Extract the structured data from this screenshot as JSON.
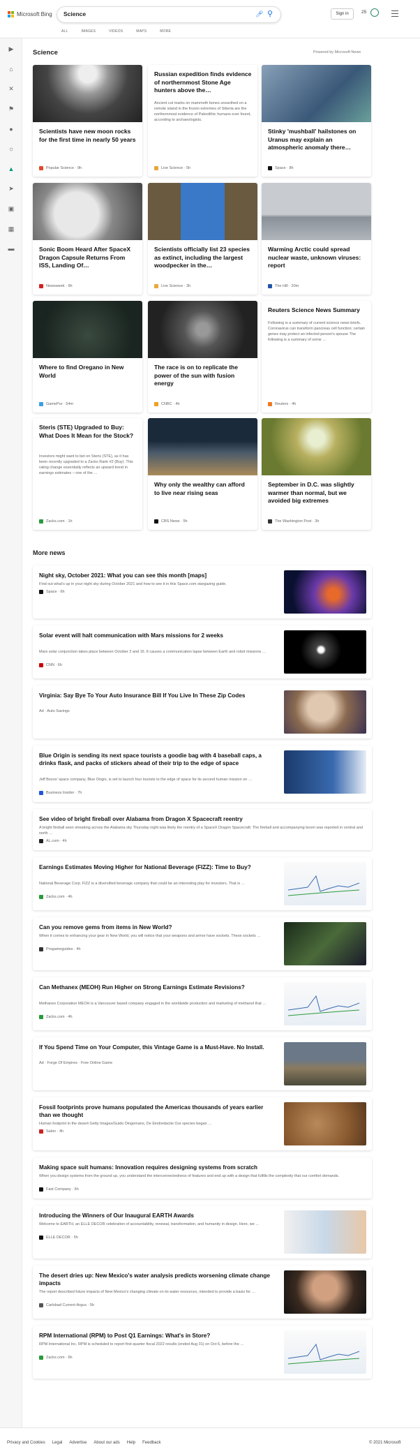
{
  "header": {
    "brand": "Microsoft Bing",
    "query": "Science",
    "signin": "Sign in",
    "rewards": "25",
    "tabs": [
      "ALL",
      "IMAGES",
      "VIDEOS",
      "MAPS",
      "MORE"
    ]
  },
  "section": {
    "title": "Science",
    "powered": "Powered by Microsoft News"
  },
  "cards": [
    {
      "title": "Scientists have new moon rocks for the first time in nearly 50 years",
      "source": "Popular Science · 9h",
      "color": "#e04a2a",
      "img": "moon"
    },
    {
      "title": "Russian expedition finds evidence of northernmost Stone Age hunters above the…",
      "desc": "Ancient cut marks on mammoth bones unearthed on a remote island in the frozen extremes of Siberia are the northernmost evidence of Paleolithic humans ever found, according to archaeologists.",
      "source": "Live Science · 5h",
      "color": "#e8a83a",
      "img": "text"
    },
    {
      "title": "Stinky 'mushball' hailstones on Uranus may explain an atmospheric anomaly there…",
      "source": "Space · 8h",
      "color": "#111",
      "img": "uranus"
    },
    {
      "title": "Sonic Boom Heard After SpaceX Dragon Capsule Returns From ISS, Landing Of…",
      "source": "Newsweek · 9h",
      "color": "#d62020",
      "img": "capsule"
    },
    {
      "title": "Scientists officially list 23 species as extinct, including the largest woodpecker in the…",
      "source": "Live Science · 3h",
      "color": "#e8a83a",
      "img": "woodpecker"
    },
    {
      "title": "Warming Arctic could spread nuclear waste, unknown viruses: report",
      "source": "The Hill · 20m",
      "color": "#2255aa",
      "img": "arctic"
    },
    {
      "title": "Where to find Oregano in New World",
      "source": "GamePur · 54m",
      "color": "#3aa0e0",
      "img": "oregano"
    },
    {
      "title": "The race is on to replicate the power of the sun with fusion energy",
      "source": "CNBC · 4h",
      "color": "#f0a020",
      "img": "fusion"
    },
    {
      "title": "Reuters Science News Summary",
      "desc": "Following is a summary of current science news briefs. Coronavirus can transform pancreas cell function; certain genes may protect an infected person's spouse The following is a summary of some …",
      "source": "Reuters · 4h",
      "color": "#f07820",
      "img": "text"
    },
    {
      "title": "Steris (STE) Upgraded to Buy: What Does It Mean for the Stock?",
      "desc": "Investors might want to bet on Steris (STE), as it has been recently upgraded to a Zacks Rank #2 (Buy). This rating change essentially reflects an upward trend in earnings estimates – one of the …",
      "source": "Zacks.com · 1h",
      "color": "#2a9a3a",
      "img": "text"
    },
    {
      "title": "Why only the wealthy can afford to live near rising seas",
      "source": "CBS News · 5h",
      "color": "#111",
      "img": "flood"
    },
    {
      "title": "September in D.C. was slightly warmer than normal, but we avoided big extremes",
      "source": "The Washington Post · 3h",
      "color": "#333",
      "img": "dandelion"
    }
  ],
  "more": {
    "title": "More news",
    "items": [
      {
        "title": "Night sky, October 2021: What you can see this month [maps]",
        "desc": "Find out what's up in your night sky during October 2021 and how to see it in this Space.com stargazing guide.",
        "source": "Space · 6h",
        "color": "#111",
        "img": "nightsky"
      },
      {
        "title": "Solar event will halt communication with Mars missions for 2 weeks",
        "desc": "Mars solar conjunction takes place between October 2 and 16. It causes a communication lapse between Earth and robot missions …",
        "source": "CNN · 6h",
        "color": "#cc0000",
        "img": "sun"
      },
      {
        "title": "Virginia: Say Bye To Your Auto Insurance Bill If You Live In These Zip Codes",
        "desc": "",
        "source": "Ad · Auto Savings",
        "color": "",
        "img": "oldman"
      },
      {
        "title": "Blue Origin is sending its next space tourists a goodie bag with 4 baseball caps, a drinks flask, and packs of stickers ahead of their trip to the edge of space",
        "desc": "Jeff Bezos' space company, Blue Origin, is set to launch four tourists to the edge of space for its second human mission on …",
        "source": "Business Insider · 7h",
        "color": "#2255dd",
        "img": "bezos"
      },
      {
        "title": "See video of bright fireball over Alabama from Dragon X Spacecraft reentry",
        "desc": "A bright fireball seen streaking across the Alabama sky Thursday night was likely the reentry of a SpaceX Dragon Spacecraft. The fireball and accompanying boom was reported in central and north …",
        "source": "AL.com · 4h",
        "color": "#222",
        "img": ""
      },
      {
        "title": "Earnings Estimates Moving Higher for National Beverage (FIZZ): Time to Buy?",
        "desc": "National Beverage Corp. FIZZ is a diversified beverage company that could be an interesting play for investors. That is …",
        "source": "Zacks.com · 4h",
        "color": "#2a9a3a",
        "img": "chart"
      },
      {
        "title": "Can you remove gems from items in New World?",
        "desc": "When it comes to enhancing your gear in New World, you will notice that your weapons and armor have sockets. These sockets …",
        "source": "Progameguides · 4h",
        "color": "#333",
        "img": "game"
      },
      {
        "title": "Can Methanex (MEOH) Run Higher on Strong Earnings Estimate Revisions?",
        "desc": "Methanex Corporation MEOH is a Vancouver based company engaged in the worldwide production and marketing of methanol that …",
        "source": "Zacks.com · 4h",
        "color": "#2a9a3a",
        "img": "chart"
      },
      {
        "title": "If You Spend Time on Your Computer, this Vintage Game is a Must-Have. No Install.",
        "desc": "",
        "source": "Ad · Forge Of Empires · Free Online Game",
        "color": "",
        "img": "city"
      },
      {
        "title": "Fossil footprints prove humans populated the Americas thousands of years earlier than we thought",
        "desc": "Human footprint in the desert Getty Images/Guido Dingemans, De Eindredactie Our species began …",
        "source": "Salon · 4h",
        "color": "#cc2222",
        "img": "mud"
      },
      {
        "title": "Making space suit humans: Innovation requires designing systems from scratch",
        "desc": "When you design systems from the ground up, you understand the interconnectedness of features and end up with a design that fulfills the complexity that our comfort demands.",
        "source": "Fast Company · 6h",
        "color": "#111",
        "img": ""
      },
      {
        "title": "Introducing the Winners of Our Inaugural EARTH Awards",
        "desc": "Welcome to EARTH, an ELLE DECOR celebration of accountability, renewal, transformation, and humanity in design. Here, we …",
        "source": "ELLE DECOR · 5h",
        "color": "#111",
        "img": "earth"
      },
      {
        "title": "The desert dries up: New Mexico's water analysis predicts worsening climate change impacts",
        "desc": "The report described future impacts of New Mexico's changing climate on its water resources, intended to provide a basis for …",
        "source": "Carlsbad Current-Argus · 5h",
        "color": "#555",
        "img": "portrait"
      },
      {
        "title": "RPM International (RPM) to Post Q1 Earnings: What's in Store?",
        "desc": "RPM International Inc. RPM is scheduled to report first-quarter fiscal 2022 results (ended Aug 31) on Oct 6, before the …",
        "source": "Zacks.com · 6h",
        "color": "#2a9a3a",
        "img": "chart2"
      }
    ]
  },
  "footer": {
    "links": [
      "Privacy and Cookies",
      "Legal",
      "Advertise",
      "About our ads",
      "Help",
      "Feedback"
    ],
    "copyright": "© 2021 Microsoft"
  }
}
